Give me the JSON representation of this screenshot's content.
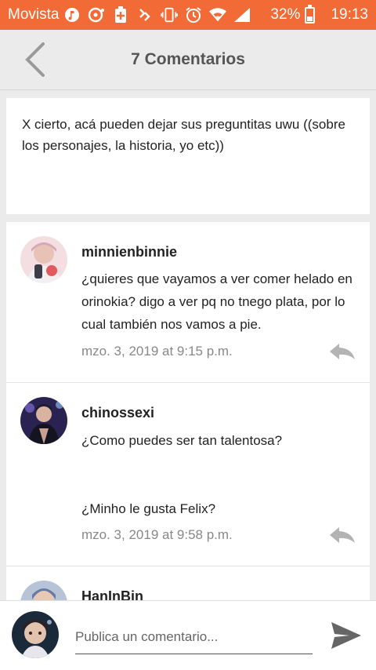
{
  "status_bar": {
    "carrier": "Movista",
    "battery": "32%",
    "battery_level": 0.32,
    "time": "19:13",
    "icons": [
      "music-icon",
      "chat-notification-icon",
      "battery-saver-icon",
      "signal-boost-icon",
      "vibrate-icon",
      "alarm-icon",
      "wifi-icon",
      "cell-signal-icon"
    ],
    "color": "#f26a35"
  },
  "header": {
    "title": "7 Comentarios",
    "back_icon": "chevron-left-icon"
  },
  "post": {
    "text": "X cierto, acá pueden dejar sus preguntitas uwu ((sobre los personajes, la historia, yo etc))"
  },
  "comments": [
    {
      "user": "minnienbinnie",
      "text": "¿quieres que vayamos a ver comer helado en orinokia? digo a ver pq no tnego plata, por lo cual también nos vamos a pie.",
      "date": "mzo. 3, 2019 at 9:15 p.m."
    },
    {
      "user": "chinossexi",
      "text": "¿Como puedes ser tan talentosa?\n\n\n¿Minho le gusta Felix?",
      "date": "mzo. 3, 2019 at 9:58 p.m."
    },
    {
      "user": "HanInBin"
    }
  ],
  "compose": {
    "placeholder": "Publica un comentario...",
    "send_icon": "send-icon"
  }
}
